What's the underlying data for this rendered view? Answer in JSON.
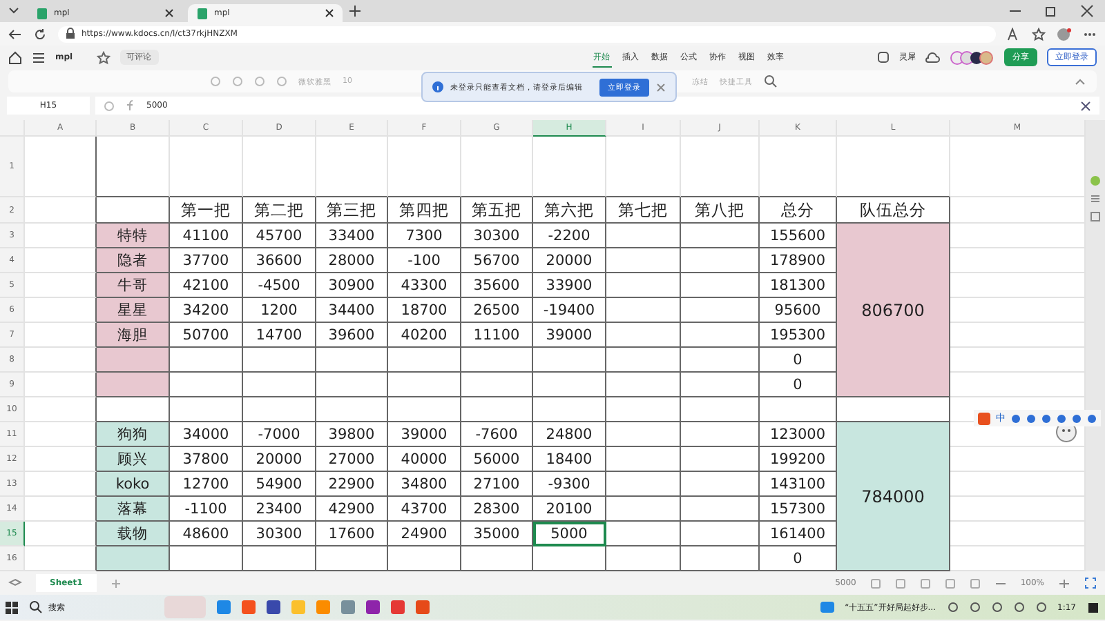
{
  "browser": {
    "tabs": [
      {
        "title": "mpl",
        "selected": false
      },
      {
        "title": "mpl",
        "selected": true
      }
    ],
    "url": "https://www.kdocs.cn/l/ct37rkjHNZXM"
  },
  "app": {
    "doc_title": "mpl",
    "permission": "可评论",
    "menu": [
      {
        "label": "开始",
        "selected": true
      },
      {
        "label": "插入",
        "selected": false
      },
      {
        "label": "数据",
        "selected": false
      },
      {
        "label": "公式",
        "selected": false
      },
      {
        "label": "协作",
        "selected": false
      },
      {
        "label": "视图",
        "selected": false
      },
      {
        "label": "效率",
        "selected": false
      }
    ],
    "ai_label": "灵犀",
    "share": "分享",
    "login": "立即登录"
  },
  "toolbar": {
    "font": "微软雅黑",
    "size": "10",
    "freeze": "冻结",
    "quick_tools": "快捷工具"
  },
  "notice": {
    "text": "未登录只能查看文档，请登录后编辑",
    "button": "立即登录"
  },
  "formula_bar": {
    "cell": "H15",
    "value": "5000"
  },
  "sheet": {
    "columns": [
      {
        "label": "A",
        "selected": false
      },
      {
        "label": "B",
        "selected": false
      },
      {
        "label": "C",
        "selected": false
      },
      {
        "label": "D",
        "selected": false
      },
      {
        "label": "E",
        "selected": false
      },
      {
        "label": "F",
        "selected": false
      },
      {
        "label": "G",
        "selected": false
      },
      {
        "label": "H",
        "selected": true
      },
      {
        "label": "I",
        "selected": false
      },
      {
        "label": "J",
        "selected": false
      },
      {
        "label": "K",
        "selected": false
      },
      {
        "label": "L",
        "selected": false
      },
      {
        "label": "M",
        "selected": false
      }
    ],
    "row_numbers": [
      {
        "label": "1",
        "selected": false
      },
      {
        "label": "2",
        "selected": false
      },
      {
        "label": "3",
        "selected": false
      },
      {
        "label": "4",
        "selected": false
      },
      {
        "label": "5",
        "selected": false
      },
      {
        "label": "6",
        "selected": false
      },
      {
        "label": "7",
        "selected": false
      },
      {
        "label": "8",
        "selected": false
      },
      {
        "label": "9",
        "selected": false
      },
      {
        "label": "10",
        "selected": false
      },
      {
        "label": "11",
        "selected": false
      },
      {
        "label": "12",
        "selected": false
      },
      {
        "label": "13",
        "selected": false
      },
      {
        "label": "14",
        "selected": false
      },
      {
        "label": "15",
        "selected": true
      },
      {
        "label": "16",
        "selected": false
      }
    ],
    "headers": [
      "第一把",
      "第二把",
      "第三把",
      "第四把",
      "第五把",
      "第六把",
      "第七把",
      "第八把",
      "总分",
      "队伍总分"
    ],
    "teams": [
      {
        "color": "#e8c8d0",
        "total": "806700",
        "rows": [
          {
            "name": "特特",
            "scores": [
              "41100",
              "45700",
              "33400",
              "7300",
              "30300",
              "-2200"
            ],
            "total": "155600"
          },
          {
            "name": "隐者",
            "scores": [
              "37700",
              "36600",
              "28000",
              "-100",
              "56700",
              "20000"
            ],
            "total": "178900"
          },
          {
            "name": "牛哥",
            "scores": [
              "42100",
              "-4500",
              "30900",
              "43300",
              "35600",
              "33900"
            ],
            "total": "181300"
          },
          {
            "name": "星星",
            "scores": [
              "34200",
              "1200",
              "34400",
              "18700",
              "26500",
              "-19400"
            ],
            "total": "95600"
          },
          {
            "name": "海胆",
            "scores": [
              "50700",
              "14700",
              "39600",
              "40200",
              "11100",
              "39000"
            ],
            "total": "195300"
          },
          {
            "total": "0"
          },
          {
            "total": "0"
          }
        ]
      },
      {
        "color": "#c8e6df",
        "total": "784000",
        "rows": [
          {
            "name": "狗狗",
            "scores": [
              "34000",
              "-7000",
              "39800",
              "39000",
              "-7600",
              "24800"
            ],
            "total": "123000"
          },
          {
            "name": "顾兴",
            "scores": [
              "37800",
              "20000",
              "27000",
              "40000",
              "56000",
              "18400"
            ],
            "total": "199200"
          },
          {
            "name": "koko",
            "scores": [
              "12700",
              "54900",
              "22900",
              "34800",
              "27100",
              "-9300"
            ],
            "total": "143100"
          },
          {
            "name": "落幕",
            "scores": [
              "-1100",
              "23400",
              "42900",
              "43700",
              "28300",
              "20100"
            ],
            "total": "157300"
          },
          {
            "name": "载物",
            "scores": [
              "48600",
              "30300",
              "17600",
              "24900",
              "35000",
              "5000"
            ],
            "total": "161400"
          },
          {
            "total": "0"
          }
        ]
      }
    ]
  },
  "sheet_tabs": [
    {
      "label": "Sheet1",
      "selected": true
    }
  ],
  "status": {
    "value": "5000",
    "zoom": "100%"
  },
  "ime": {
    "mode": "中"
  },
  "taskbar": {
    "search": "搜索",
    "news": "“十五五”开好局起好步...",
    "time": "1:17"
  }
}
